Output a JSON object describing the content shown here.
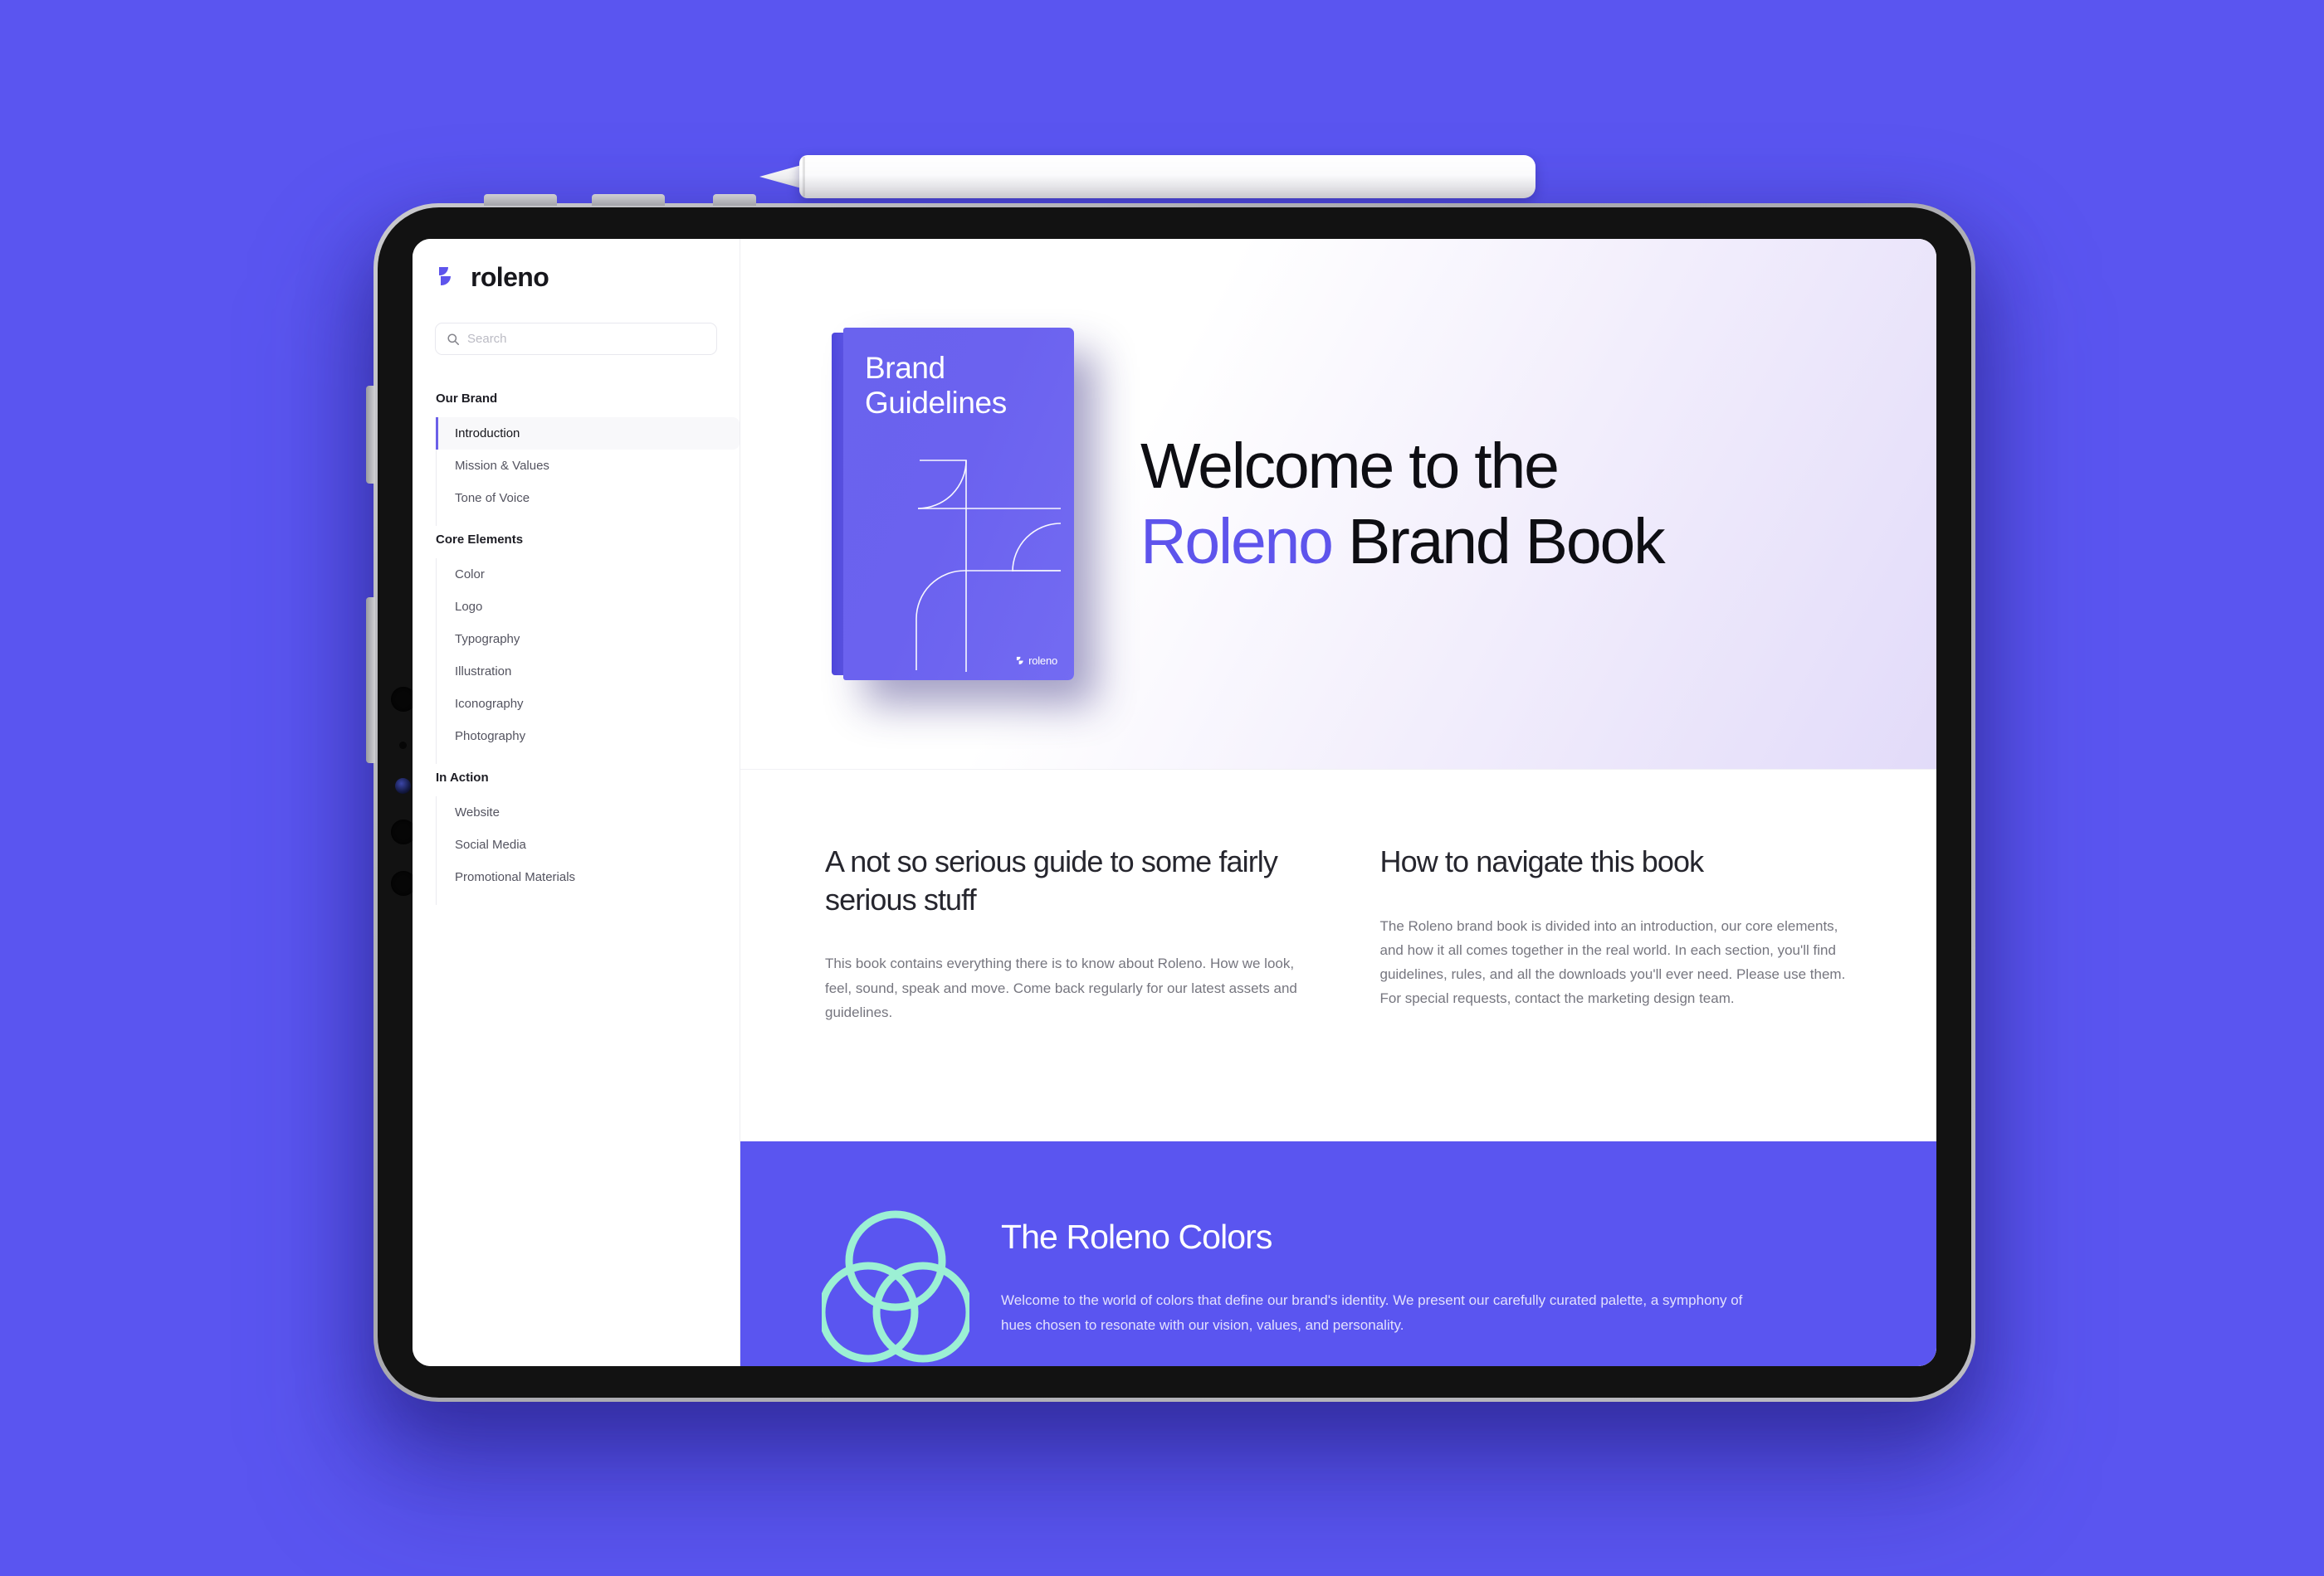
{
  "scene": {
    "background_color": "#5A55F0",
    "accent_color": "#5E54EC",
    "mint_color": "#9CF0D4"
  },
  "device": {
    "stylus_name": "stylus-pen",
    "buttons": {
      "volume_up": "volume-up-button",
      "volume_down": "volume-down-button",
      "power": "power-button"
    }
  },
  "sidebar": {
    "logo": {
      "mark": "roleno-logo-mark",
      "wordmark": "roleno"
    },
    "search": {
      "placeholder": "Search",
      "value": "",
      "icon": "search-icon"
    },
    "groups": [
      {
        "title": "Our Brand",
        "items": [
          {
            "label": "Introduction",
            "active": true
          },
          {
            "label": "Mission & Values",
            "active": false
          },
          {
            "label": "Tone of Voice",
            "active": false
          }
        ]
      },
      {
        "title": "Core Elements",
        "items": [
          {
            "label": "Color",
            "active": false
          },
          {
            "label": "Logo",
            "active": false
          },
          {
            "label": "Typography",
            "active": false
          },
          {
            "label": "Illustration",
            "active": false
          },
          {
            "label": "Iconography",
            "active": false
          },
          {
            "label": "Photography",
            "active": false
          }
        ]
      },
      {
        "title": "In Action",
        "items": [
          {
            "label": "Website",
            "active": false
          },
          {
            "label": "Social Media",
            "active": false
          },
          {
            "label": "Promotional Materials",
            "active": false
          }
        ]
      }
    ]
  },
  "hero": {
    "book": {
      "title_line1": "Brand",
      "title_line2": "Guidelines",
      "logo_text": "roleno",
      "cover_color": "#6B62EF"
    },
    "heading_line1": "Welcome to the",
    "heading_accent": "Roleno",
    "heading_line2_rest": " Brand Book"
  },
  "info": {
    "columns": [
      {
        "heading": "A not so serious guide to some fairly serious stuff",
        "body": "This book contains everything there is to know about Roleno. How we look, feel, sound, speak and move. Come back regularly for our latest assets and guidelines."
      },
      {
        "heading": "How to navigate this book",
        "body": "The Roleno brand book is divided into an introduction, our core elements, and how it all comes together in the real world. In each section, you'll find guidelines, rules, and all the downloads you'll ever need. Please use them. For special requests, contact the marketing design team."
      }
    ]
  },
  "colors_banner": {
    "graphic": "three-overlapping-circles-icon",
    "title": "The Roleno Colors",
    "body": "Welcome to the world of colors that define our brand's identity. We present our carefully curated palette, a symphony of hues chosen to resonate with our vision, values, and personality."
  }
}
